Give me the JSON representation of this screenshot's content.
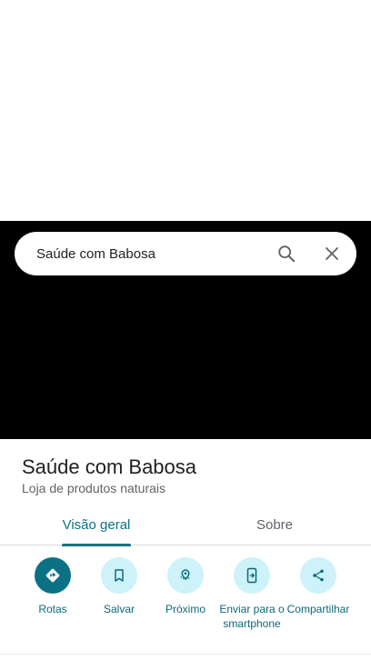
{
  "search": {
    "query": "Saúde com Babosa",
    "search_icon": "search-icon",
    "close_icon": "close-icon"
  },
  "place": {
    "name": "Saúde com Babosa",
    "category": "Loja de produtos naturais"
  },
  "tabs": [
    {
      "label": "Visão geral",
      "selected": true
    },
    {
      "label": "Sobre",
      "selected": false
    }
  ],
  "actions": [
    {
      "label": "Rotas",
      "icon": "directions-icon"
    },
    {
      "label": "Salvar",
      "icon": "bookmark-icon"
    },
    {
      "label": "Próximo",
      "icon": "nearby-icon"
    },
    {
      "label": "Enviar para o smartphone",
      "icon": "send-to-phone-icon"
    },
    {
      "label": "Compartilhar",
      "icon": "share-icon"
    }
  ],
  "colors": {
    "accent": "#0b7285",
    "action_bg": "#cdf2f9",
    "map_bg": "#000000"
  }
}
